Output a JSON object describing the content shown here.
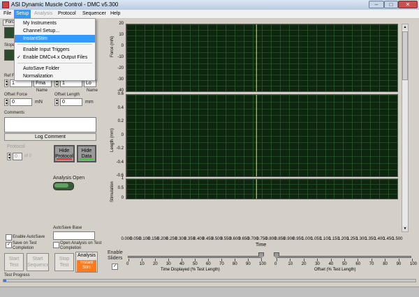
{
  "window": {
    "title": "ASI Dynamic Muscle Control - DMC v5.300",
    "minimize": "–",
    "maximize": "□",
    "close": "✕"
  },
  "menu": {
    "items": [
      {
        "label": "File",
        "state": "normal"
      },
      {
        "label": "Setup",
        "state": "selected"
      },
      {
        "label": "Analysis",
        "state": "disabled"
      },
      {
        "label": "Protocol",
        "state": "normal"
      },
      {
        "label": "Sequencer",
        "state": "normal"
      },
      {
        "label": "Help",
        "state": "normal"
      }
    ]
  },
  "setup_menu": {
    "items": [
      {
        "label": "My Instruments",
        "checked": false,
        "highlight": false
      },
      {
        "label": "Channel Setup...",
        "checked": false,
        "highlight": false
      },
      {
        "label": "InstantStim",
        "checked": false,
        "highlight": true
      },
      {
        "label": "Enable Input Triggers",
        "checked": false,
        "highlight": false
      },
      {
        "label": "Enable DMCv4.x Output Files",
        "checked": true,
        "highlight": false
      },
      {
        "label": "AutoSave Folder",
        "checked": false,
        "highlight": false
      },
      {
        "label": "Normalization",
        "checked": false,
        "highlight": false
      }
    ],
    "check_glyph": "✓"
  },
  "left": {
    "force_tab": "Forc",
    "slope_label": "Slope",
    "ref_label": "Ref F",
    "row1": {
      "value": "1",
      "unit_a": "Fma",
      "value_b": "1",
      "unit_b": "Lo"
    },
    "name_a": "Name",
    "name_b": "Name",
    "offset_force_label": "Offset Force",
    "offset_force_value": "0",
    "offset_force_unit": "mN",
    "offset_length_label": "Offset Length",
    "offset_length_value": "0",
    "offset_length_unit": "mm",
    "comments_label": "Comments",
    "comments_value": "",
    "log_comment": "Log Comment",
    "protocol_label": "Protocol",
    "protocol_value": "0",
    "protocol_of": "of 0",
    "hide_protocol": "Hide Protocol",
    "hide_data": "Hide Data",
    "analysis_open": "Analysis Open",
    "enable_autosave": "Enable AutoSave",
    "autosave_base_label": "AutoSave Base",
    "autosave_base_value": "",
    "save_on_completion": "Save on Test Completion",
    "open_analysis": "Open Analysis on Test Completion",
    "start_test": "Start Test",
    "start_sequence": "Start Sequence",
    "stop_test": "Stop Test",
    "analysis_btn": "Analysis",
    "instant_stim": "Instant Stim",
    "test_progress": "Test Progress",
    "enable_sliders": "Enable Sliders"
  },
  "chart_data": [
    {
      "type": "line",
      "ylabel": "Force (mN)",
      "ylim": [
        -40,
        20
      ],
      "yticks": [
        "20",
        "10",
        "0",
        "-10",
        "-20",
        "-30",
        "-40"
      ],
      "cursor_x": 0.72,
      "grid": true
    },
    {
      "type": "line",
      "ylabel": "Length (mm)",
      "ylim": [
        -0.6,
        0.6
      ],
      "yticks": [
        "0.6",
        "0.4",
        "0.2",
        "0",
        "-0.2",
        "-0.4",
        "-0.6"
      ],
      "cursor_x": 0.72,
      "grid": true
    },
    {
      "type": "line",
      "ylabel": "Stimulation",
      "ylim": [
        0,
        1
      ],
      "yticks": [
        "1",
        "0.5",
        "0"
      ],
      "cursor_x": 0.72,
      "grid": true
    }
  ],
  "xaxis": {
    "label": "Time",
    "xlim": [
      0,
      1.5
    ],
    "ticks": [
      "0.000",
      "0.050",
      "0.100",
      "0.150",
      "0.200",
      "0.250",
      "0.300",
      "0.350",
      "0.400",
      "0.450",
      "0.500",
      "0.550",
      "0.600",
      "0.650",
      "0.700",
      "0.750",
      "0.800",
      "0.850",
      "0.900",
      "0.950",
      "1.000",
      "1.050",
      "1.100",
      "1.150",
      "1.200",
      "1.250",
      "1.300",
      "1.350",
      "1.400",
      "1.450",
      "1.500"
    ]
  },
  "sliders": {
    "time_label": "Time Displayed (% Test Length)",
    "offset_label": "Offset (% Test Length)",
    "ticks": [
      "0",
      "10",
      "20",
      "30",
      "40",
      "50",
      "60",
      "70",
      "80",
      "90",
      "100"
    ],
    "time_value": 100,
    "offset_value": 0
  },
  "colors": {
    "graph_bg": "#0e2510",
    "grid": "#2f6a2f",
    "cursor": "#e6e64a",
    "analysis_btn": "#ff7a1a"
  }
}
